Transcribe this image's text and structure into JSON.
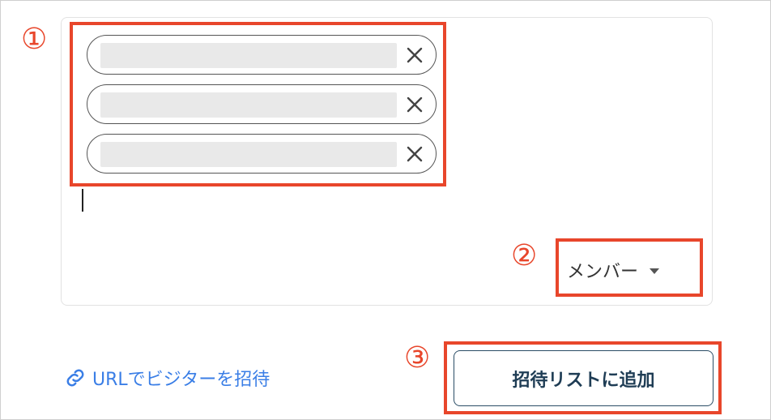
{
  "annotations": {
    "one": "①",
    "two": "②",
    "three": "③"
  },
  "invitees": [
    {
      "value": ""
    },
    {
      "value": ""
    },
    {
      "value": ""
    }
  ],
  "role_select": {
    "label": "メンバー"
  },
  "invite_link": {
    "label": "URLでビジターを招待"
  },
  "add_button": {
    "label": "招待リストに追加"
  },
  "colors": {
    "highlight": "#e8462b",
    "link": "#3a7ee6",
    "button_text": "#1f3d55"
  }
}
